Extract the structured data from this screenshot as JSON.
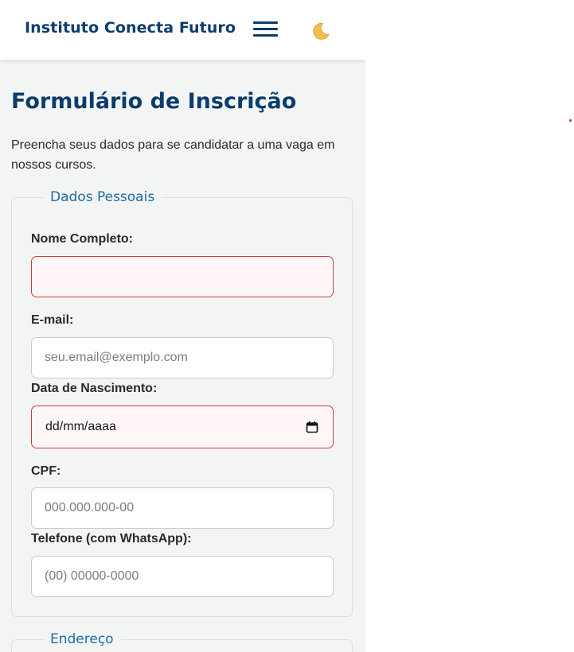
{
  "header": {
    "brand": "Instituto Conecta Futuro",
    "menu_icon": "hamburger-menu-icon",
    "theme_icon": "crescent-moon-icon"
  },
  "form": {
    "title": "Formulário de Inscrição",
    "intro": "Preencha seus dados para se candidatar a uma vaga em nossos cursos.",
    "personal": {
      "legend": "Dados Pessoais",
      "name_label": "Nome Completo:",
      "name_value": "",
      "email_label": "E-mail:",
      "email_placeholder": "seu.email@exemplo.com",
      "birth_label": "Data de Nascimento:",
      "birth_value": "dd/mm/aaaa",
      "cpf_label": "CPF:",
      "cpf_placeholder": "000.000.000-00",
      "phone_label": "Telefone (com WhatsApp):",
      "phone_placeholder": "(00) 00000-0000"
    },
    "address": {
      "legend": "Endereço"
    }
  },
  "colors": {
    "brand": "#0b3d6b",
    "legend": "#1d6aa3",
    "error_border": "#d33a3a",
    "panel_bg": "#f3f5f4"
  }
}
